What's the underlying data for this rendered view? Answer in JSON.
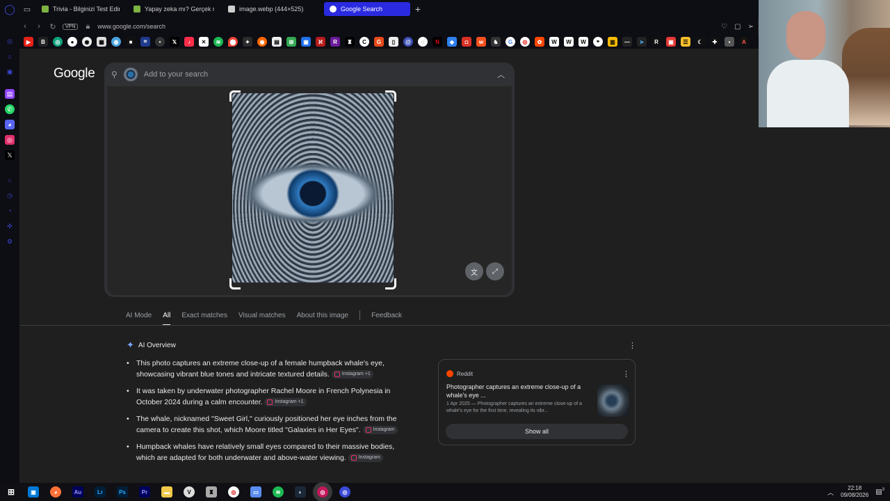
{
  "browser": {
    "tabs": [
      {
        "label": "Trivia - Bilginizi Test Edin -",
        "color": "#7cb342",
        "active": false
      },
      {
        "label": "Yapay zeka mı? Gerçek mi",
        "color": "#7cb342",
        "active": false
      },
      {
        "label": "image.webp (444×525)",
        "color": "#cfcfcf",
        "active": false
      },
      {
        "label": "Google Search",
        "color": "#ffffff",
        "active": true
      }
    ],
    "new_tab": "+",
    "vpn_label": "VPN",
    "url": "www.google.com/search"
  },
  "google": {
    "logo": "Google",
    "search_placeholder": "Add to your search"
  },
  "lens_tabs": [
    "AI Mode",
    "All",
    "Exact matches",
    "Visual matches",
    "About this image",
    "Feedback"
  ],
  "ai_overview": {
    "title": "AI Overview",
    "bullets": [
      {
        "text": "This photo captures an extreme close-up of a female humpback whale's eye, showcasing vibrant blue tones and intricate textured details.",
        "chip": "Instagram +1"
      },
      {
        "text": "It was taken by underwater photographer Rachel Moore in French Polynesia in October 2024 during a calm encounter.",
        "chip": "Instagram +1"
      },
      {
        "text": "The whale, nicknamed \"Sweet Girl,\" curiously positioned her eye inches from the camera to create this shot, which Moore titled \"Galaxies in Her Eyes\".",
        "chip": "Instagram"
      },
      {
        "text": "Humpback whales have relatively small eyes compared to their massive bodies, which are adapted for both underwater and above-water viewing.",
        "chip": "Instagram"
      }
    ]
  },
  "source_card": {
    "source": "Reddit",
    "title": "Photographer captures an extreme close-up of a whale's eye ...",
    "snippet": "1 Apr 2025 — Photographer captures an extreme close-up of a whale's eye for the first time, revealing its vibr...",
    "show_all": "Show all"
  },
  "taskbar": {
    "time": "22:18",
    "date": "09/08/2026",
    "notifications": "3"
  }
}
